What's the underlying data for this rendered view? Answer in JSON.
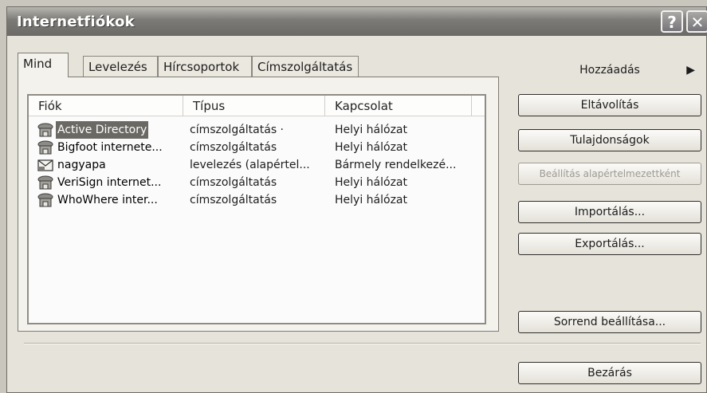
{
  "window": {
    "title": "Internetfiókok"
  },
  "titlebar": {
    "help_label": "?",
    "close_label": "✕"
  },
  "tabs": [
    {
      "label": "Mind",
      "active": true
    },
    {
      "label": "Levelezés",
      "active": false
    },
    {
      "label": "Hírcsoportok",
      "active": false
    },
    {
      "label": "Címszolgáltatás",
      "active": false
    }
  ],
  "list": {
    "columns": [
      "Fiók",
      "Típus",
      "Kapcsolat"
    ],
    "rows": [
      {
        "name": "Active Directory",
        "type": "címszolgáltatás ·",
        "connection": "Helyi hálózat",
        "selected": true,
        "icon": "directory-service-icon"
      },
      {
        "name": "Bigfoot internete...",
        "type": "címszolgáltatás",
        "connection": "Helyi hálózat",
        "selected": false,
        "icon": "directory-service-icon"
      },
      {
        "name": "nagyapa",
        "type": "levelezés (alapértel...",
        "connection": "Bármely rendelkezé...",
        "selected": false,
        "icon": "mail-account-icon"
      },
      {
        "name": "VeriSign internet...",
        "type": "címszolgáltatás",
        "connection": "Helyi hálózat",
        "selected": false,
        "icon": "directory-service-icon"
      },
      {
        "name": "WhoWhere inter...",
        "type": "címszolgáltatás",
        "connection": "Helyi hálózat",
        "selected": false,
        "icon": "directory-service-icon"
      }
    ]
  },
  "buttons": {
    "add": "Hozzáadás",
    "add_arrow": "▶",
    "remove": "Eltávolítás",
    "properties": "Tulajdonságok",
    "set_default": "Beállítás alapértelmezettként",
    "import": "Importálás...",
    "export": "Exportálás...",
    "order": "Sorrend beállítása...",
    "close": "Bezárás"
  },
  "colors": {
    "titlebar": "#6b6a67",
    "selection": "#6b6964",
    "dialog_background": "#e6e3da"
  }
}
